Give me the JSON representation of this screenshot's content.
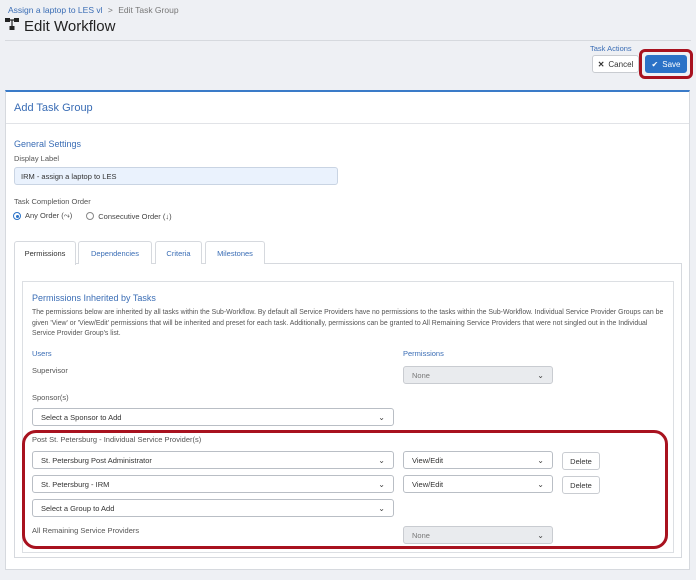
{
  "breadcrumb": {
    "link": "Assign a laptop to LES vl",
    "separator": ">",
    "current": "Edit Task Group"
  },
  "header": {
    "title": "Edit Workflow"
  },
  "task_actions": {
    "label": "Task Actions",
    "cancel": "Cancel",
    "save": "Save"
  },
  "panel": {
    "title": "Add Task Group"
  },
  "general": {
    "title": "General Settings",
    "display_label": "Display Label",
    "display_value": "IRM - assign a laptop to LES",
    "completion_label": "Task Completion Order",
    "any_order": "Any Order (⤳)",
    "consecutive_order": "Consecutive Order (↓)"
  },
  "tabs": [
    {
      "label": "Permissions"
    },
    {
      "label": "Dependencies"
    },
    {
      "label": "Criteria"
    },
    {
      "label": "Milestones"
    }
  ],
  "permissions": {
    "title": "Permissions Inherited by Tasks",
    "description": "The permissions below are inherited by all tasks within the Sub-Workflow. By default all Service Providers have no permissions to the tasks within the Sub-Workflow. Individual Service Provider Groups can be given 'View' or 'View/Edit' permissions that will be inherited and preset for each task. Additionally, permissions can be granted to All Remaining Service Providers that were not singled out in the Individual Service Provider Group's list.",
    "users_head": "Users",
    "permissions_head": "Permissions",
    "supervisor_label": "Supervisor",
    "supervisor_perm": "None",
    "sponsors_label": "Sponsor(s)",
    "sponsor_select": "Select a Sponsor to Add",
    "post_label": "Post St. Petersburg - Individual Service Provider(s)",
    "providers": [
      {
        "name": "St. Petersburg Post Administrator",
        "perm": "View/Edit",
        "delete": "Delete"
      },
      {
        "name": "St. Petersburg - IRM",
        "perm": "View/Edit",
        "delete": "Delete"
      }
    ],
    "group_select": "Select a Group to Add",
    "remaining_label": "All Remaining Service Providers",
    "remaining_perm": "None"
  },
  "colors": {
    "accent": "#3a6db5",
    "save": "#2b72c7",
    "highlight": "#a8121f"
  }
}
